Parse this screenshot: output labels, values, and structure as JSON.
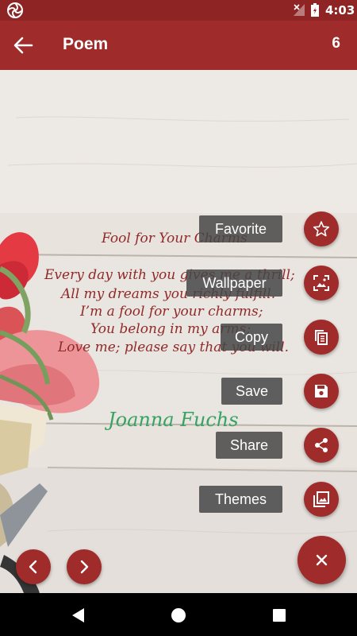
{
  "status_bar": {
    "time": "4:03",
    "icons": [
      "app-logo-icon",
      "signal-off-icon",
      "battery-charging-icon"
    ]
  },
  "app_bar": {
    "title": "Poem",
    "count": "6",
    "back_icon": "arrow-back-icon"
  },
  "poem": {
    "title": "Fool for Your Charms",
    "lines": [
      "Every day with you gives me a thrill;",
      "All my dreams you richly fulfill.",
      "I’m a fool for your charms;",
      "You belong in my arms;",
      "Love me; please say that you will."
    ],
    "author": "Joanna Fuchs"
  },
  "fab_menu": {
    "items": [
      {
        "label": "Favorite",
        "icon": "star-outline-icon"
      },
      {
        "label": "Wallpaper",
        "icon": "wallpaper-icon"
      },
      {
        "label": "Copy",
        "icon": "copy-icon"
      },
      {
        "label": "Save",
        "icon": "save-icon"
      },
      {
        "label": "Share",
        "icon": "share-icon"
      },
      {
        "label": "Themes",
        "icon": "themes-icon"
      }
    ],
    "close_icon": "close-icon"
  },
  "navigation": {
    "prev_icon": "chevron-left-icon",
    "next_icon": "chevron-right-icon"
  },
  "system_nav": [
    "back-triangle-icon",
    "home-circle-icon",
    "recents-square-icon"
  ],
  "colors": {
    "primary": "#9f2b2b",
    "status_bar": "#8e2424",
    "poem_text": "#8b1d1d",
    "author": "#2d9f5b"
  }
}
